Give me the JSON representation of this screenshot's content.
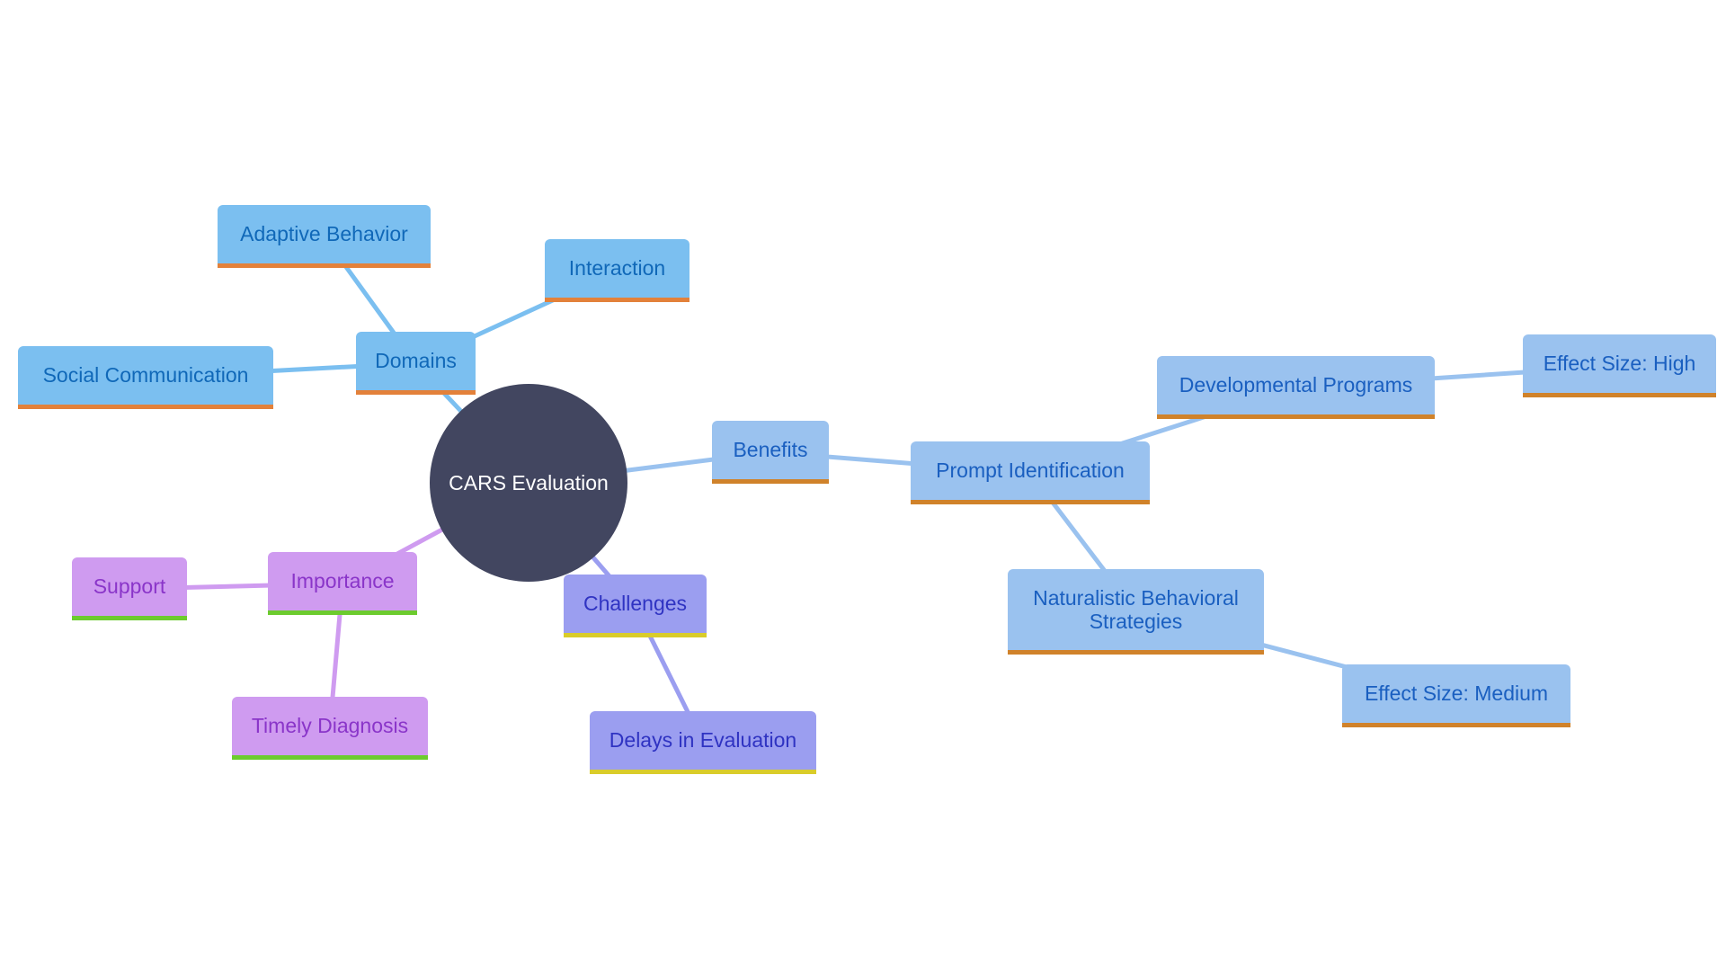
{
  "diagram": {
    "type": "mindmap",
    "root": {
      "id": "root",
      "label": "CARS Evaluation"
    },
    "colors": {
      "root_fill": "#424660",
      "root_text": "#ffffff",
      "domains": {
        "fill": "#7bbff0",
        "text": "#1068b8",
        "underline": "#e3813a",
        "edge": "#7bbff0"
      },
      "benefits": {
        "fill": "#9ac2ef",
        "text": "#1a5fc0",
        "underline": "#d0822a",
        "edge": "#9ac2ef"
      },
      "importance": {
        "fill": "#cf9bf0",
        "text": "#8a35c9",
        "underline": "#6ccb2e",
        "edge": "#cf9bf0"
      },
      "challenges": {
        "fill": "#9b9ef0",
        "text": "#2f33c2",
        "underline": "#d9cc2a",
        "edge": "#9b9ef0"
      }
    },
    "nodes": {
      "domains": {
        "label": "Domains",
        "parent": "root",
        "branch": "domains"
      },
      "adaptive": {
        "label": "Adaptive Behavior",
        "parent": "domains",
        "branch": "domains"
      },
      "interaction": {
        "label": "Interaction",
        "parent": "domains",
        "branch": "domains"
      },
      "social": {
        "label": "Social Communication",
        "parent": "domains",
        "branch": "domains"
      },
      "benefits": {
        "label": "Benefits",
        "parent": "root",
        "branch": "benefits"
      },
      "prompt": {
        "label": "Prompt Identification",
        "parent": "benefits",
        "branch": "benefits"
      },
      "devprog": {
        "label": "Developmental Programs",
        "parent": "prompt",
        "branch": "benefits"
      },
      "effecthigh": {
        "label": "Effect Size: High",
        "parent": "devprog",
        "branch": "benefits"
      },
      "naturalistic": {
        "label": "Naturalistic Behavioral Strategies",
        "parent": "prompt",
        "branch": "benefits"
      },
      "effectmed": {
        "label": "Effect Size: Medium",
        "parent": "naturalistic",
        "branch": "benefits"
      },
      "importance": {
        "label": "Importance",
        "parent": "root",
        "branch": "importance"
      },
      "support": {
        "label": "Support",
        "parent": "importance",
        "branch": "importance"
      },
      "timely": {
        "label": "Timely Diagnosis",
        "parent": "importance",
        "branch": "importance"
      },
      "challenges": {
        "label": "Challenges",
        "parent": "root",
        "branch": "challenges"
      },
      "delays": {
        "label": "Delays in Evaluation",
        "parent": "challenges",
        "branch": "challenges"
      }
    }
  }
}
